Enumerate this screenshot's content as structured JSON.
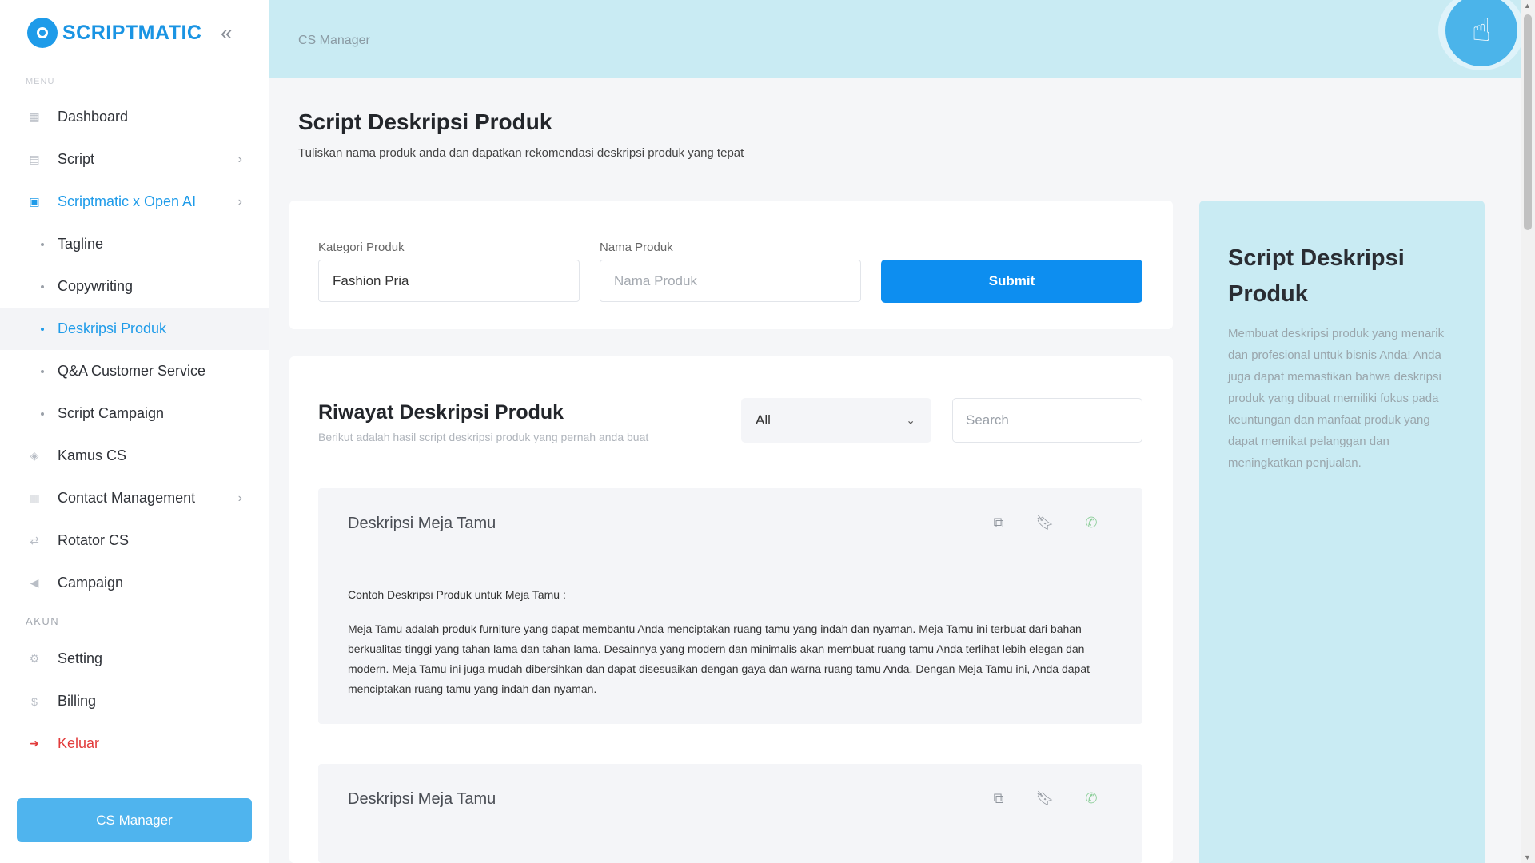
{
  "brand": {
    "name": "SCRIPTMATIC"
  },
  "sidebar": {
    "faded_section": "MENU",
    "items": [
      {
        "label": "Dashboard",
        "icon": "dashboard-icon"
      },
      {
        "label": "Script",
        "icon": "script-icon"
      },
      {
        "label": "Scriptmatic x Open AI",
        "icon": "robot-icon"
      },
      {
        "label": "Tagline"
      },
      {
        "label": "Copywriting"
      },
      {
        "label": "Deskripsi Produk"
      },
      {
        "label": "Q&A Customer Service"
      },
      {
        "label": "Script Campaign"
      },
      {
        "label": "Kamus CS",
        "icon": "book-icon"
      },
      {
        "label": "Contact Management",
        "icon": "contacts-icon"
      },
      {
        "label": "Rotator CS",
        "icon": "rotate-icon"
      },
      {
        "label": "Campaign",
        "icon": "megaphone-icon"
      }
    ],
    "account_section": "AKUN",
    "account_items": [
      {
        "label": "Setting",
        "icon": "gear-icon"
      },
      {
        "label": "Billing",
        "icon": "dollar-icon"
      },
      {
        "label": "Keluar",
        "icon": "logout-icon"
      }
    ],
    "cs_manager_button": "CS Manager"
  },
  "topbar": {
    "breadcrumb": "CS Manager"
  },
  "page": {
    "title": "Script Deskripsi Produk",
    "subtitle": "Tuliskan nama produk anda dan dapatkan rekomendasi deskripsi produk yang tepat"
  },
  "form": {
    "category_label": "Kategori Produk",
    "category_value": "Fashion Pria",
    "name_label": "Nama Produk",
    "name_placeholder": "Nama Produk",
    "submit_label": "Submit"
  },
  "history": {
    "title": "Riwayat Deskripsi Produk",
    "subtitle": "Berikut adalah hasil script deskripsi produk yang pernah anda buat",
    "filter_value": "All",
    "search_placeholder": "Search",
    "results": [
      {
        "title": "Deskripsi Meja Tamu",
        "lead": "Contoh Deskripsi Produk untuk Meja Tamu :",
        "body": "Meja Tamu adalah produk furniture yang dapat membantu Anda menciptakan ruang tamu yang indah dan nyaman. Meja Tamu ini terbuat dari bahan berkualitas tinggi yang tahan lama dan tahan lama. Desainnya yang modern dan minimalis akan membuat ruang tamu Anda terlihat lebih elegan dan modern. Meja Tamu ini juga mudah dibersihkan dan dapat disesuaikan dengan gaya dan warna ruang tamu Anda. Dengan Meja Tamu ini, Anda dapat menciptakan ruang tamu yang indah dan nyaman."
      },
      {
        "title": "Deskripsi Meja Tamu"
      }
    ]
  },
  "info_panel": {
    "title": "Script Deskripsi Produk",
    "body": "Membuat deskripsi produk yang menarik dan profesional untuk bisnis Anda! Anda juga dapat memastikan bahwa deskripsi produk yang dibuat memiliki fokus pada keuntungan dan manfaat produk yang dapat memikat pelanggan dan meningkatkan penjualan."
  },
  "colors": {
    "accent": "#1e9be9",
    "submit": "#0d8ef0",
    "panel": "#c9ebf3",
    "logout": "#e23b3b"
  }
}
